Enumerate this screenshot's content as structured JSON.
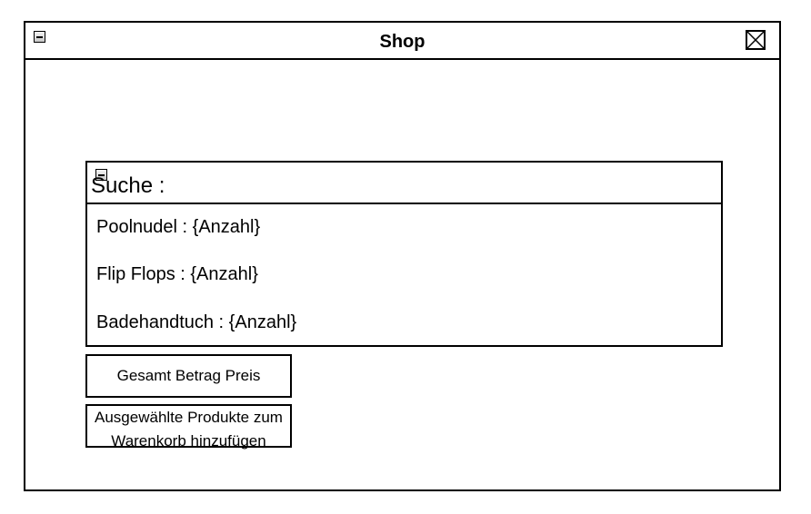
{
  "window": {
    "title": "Shop"
  },
  "search": {
    "label": "Suche :",
    "items": [
      {
        "label": "Poolnudel : {Anzahl}"
      },
      {
        "label": "Flip Flops : {Anzahl}"
      },
      {
        "label": "Badehandtuch : {Anzahl}"
      }
    ]
  },
  "buttons": {
    "total_label": "Gesamt Betrag Preis",
    "cart_label": "Ausgewählte Produkte zum Warenkorb hinzufügen"
  }
}
